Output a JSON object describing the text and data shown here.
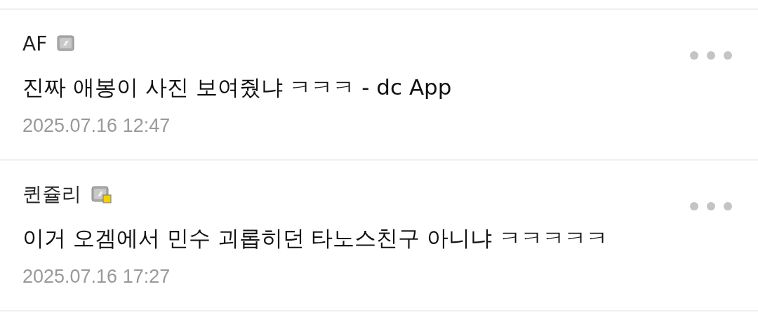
{
  "comments": [
    {
      "author": "AF",
      "badge_dot": false,
      "text": "진짜 애봉이 사진 보여줬냐 ㅋㅋㅋ - dc App",
      "date": "2025.07.16 12:47"
    },
    {
      "author": "퀸쥴리",
      "badge_dot": true,
      "text": "이거 오겜에서 민수 괴롭히던 타노스친구 아니냐 ㅋㅋㅋㅋㅋ",
      "date": "2025.07.16 17:27"
    }
  ]
}
